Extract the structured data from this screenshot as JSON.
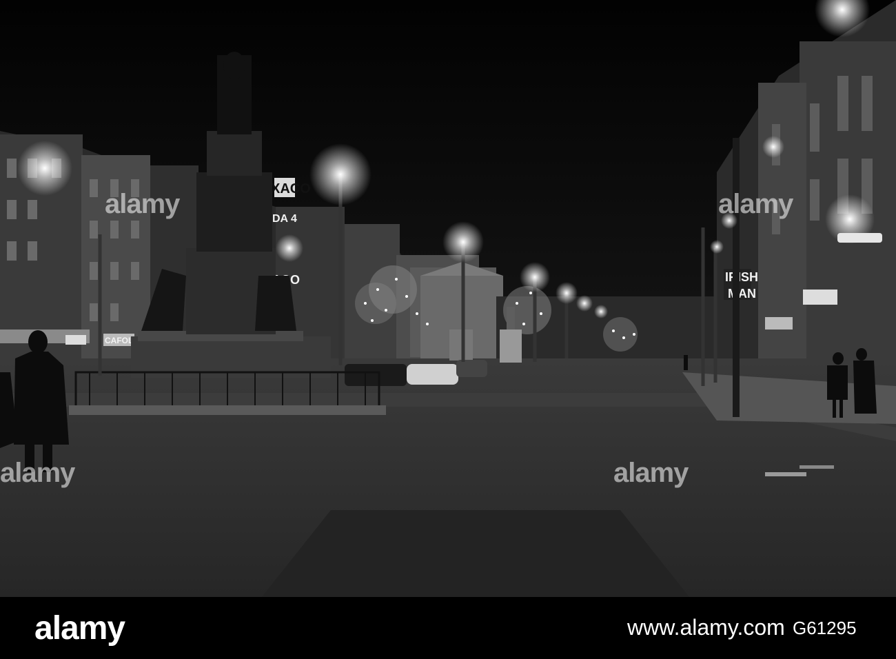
{
  "photo": {
    "description_colors": {
      "sky": "#050505",
      "road": "#2e2e2e",
      "lamp": "#ffffff"
    },
    "signs": {
      "texaco_top": "XACO",
      "texaco_bottom": "ACO",
      "side_sign_1": "DA 4",
      "irish_sign_1": "IRISH",
      "irish_sign_2": "MAN",
      "shop_sign": "CAFOL"
    }
  },
  "watermark": {
    "text": "alamy"
  },
  "footer": {
    "logo": "alamy",
    "website": "www.alamy.com",
    "image_id": "G61295"
  }
}
